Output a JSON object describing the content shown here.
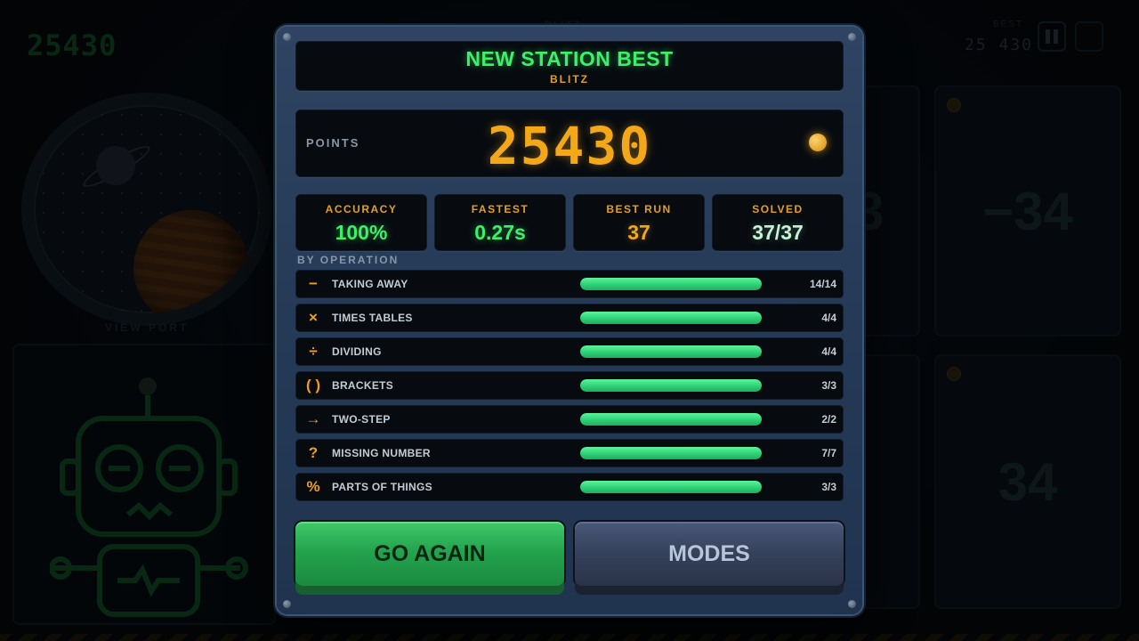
{
  "background": {
    "score": "25430",
    "mode": "BLITZ",
    "best_label": "BEST",
    "best": "25 430",
    "view_port_label": "VIEW PORT",
    "cards": [
      "3",
      "−34",
      "34"
    ]
  },
  "modal": {
    "title": "NEW STATION BEST",
    "subtitle": "BLITZ",
    "points_label": "POINTS",
    "points_value": "25430",
    "stats": [
      {
        "label": "ACCURACY",
        "value": "100%",
        "color": "#3df06a"
      },
      {
        "label": "FASTEST",
        "value": "0.27s",
        "color": "#3df06a"
      },
      {
        "label": "BEST RUN",
        "value": "37",
        "color": "#f2a818"
      },
      {
        "label": "SOLVED",
        "value": "37/37",
        "color": "#c9f0d6"
      }
    ],
    "by_operation_label": "BY OPERATION",
    "operations": [
      {
        "icon": "minus-icon",
        "glyph": "−",
        "label": "TAKING AWAY",
        "count": "14/14",
        "progress": 1.0
      },
      {
        "icon": "times-icon",
        "glyph": "×",
        "label": "TIMES TABLES",
        "count": "4/4",
        "progress": 1.0
      },
      {
        "icon": "divide-icon",
        "glyph": "÷",
        "label": "DIVIDING",
        "count": "4/4",
        "progress": 1.0
      },
      {
        "icon": "brackets-icon",
        "glyph": "( )",
        "label": "BRACKETS",
        "count": "3/3",
        "progress": 1.0
      },
      {
        "icon": "arrow-right-icon",
        "glyph": "→",
        "label": "TWO-STEP",
        "count": "2/2",
        "progress": 1.0
      },
      {
        "icon": "question-icon",
        "glyph": "?",
        "label": "MISSING NUMBER",
        "count": "7/7",
        "progress": 1.0
      },
      {
        "icon": "percent-icon",
        "glyph": "%",
        "label": "PARTS OF THINGS",
        "count": "3/3",
        "progress": 1.0
      }
    ],
    "buttons": {
      "go_again": "GO AGAIN",
      "modes": "MODES"
    }
  },
  "colors": {
    "accent_green": "#3df06a",
    "accent_amber": "#f2a818",
    "panel": "#070b10",
    "frame": "#2a4060"
  }
}
